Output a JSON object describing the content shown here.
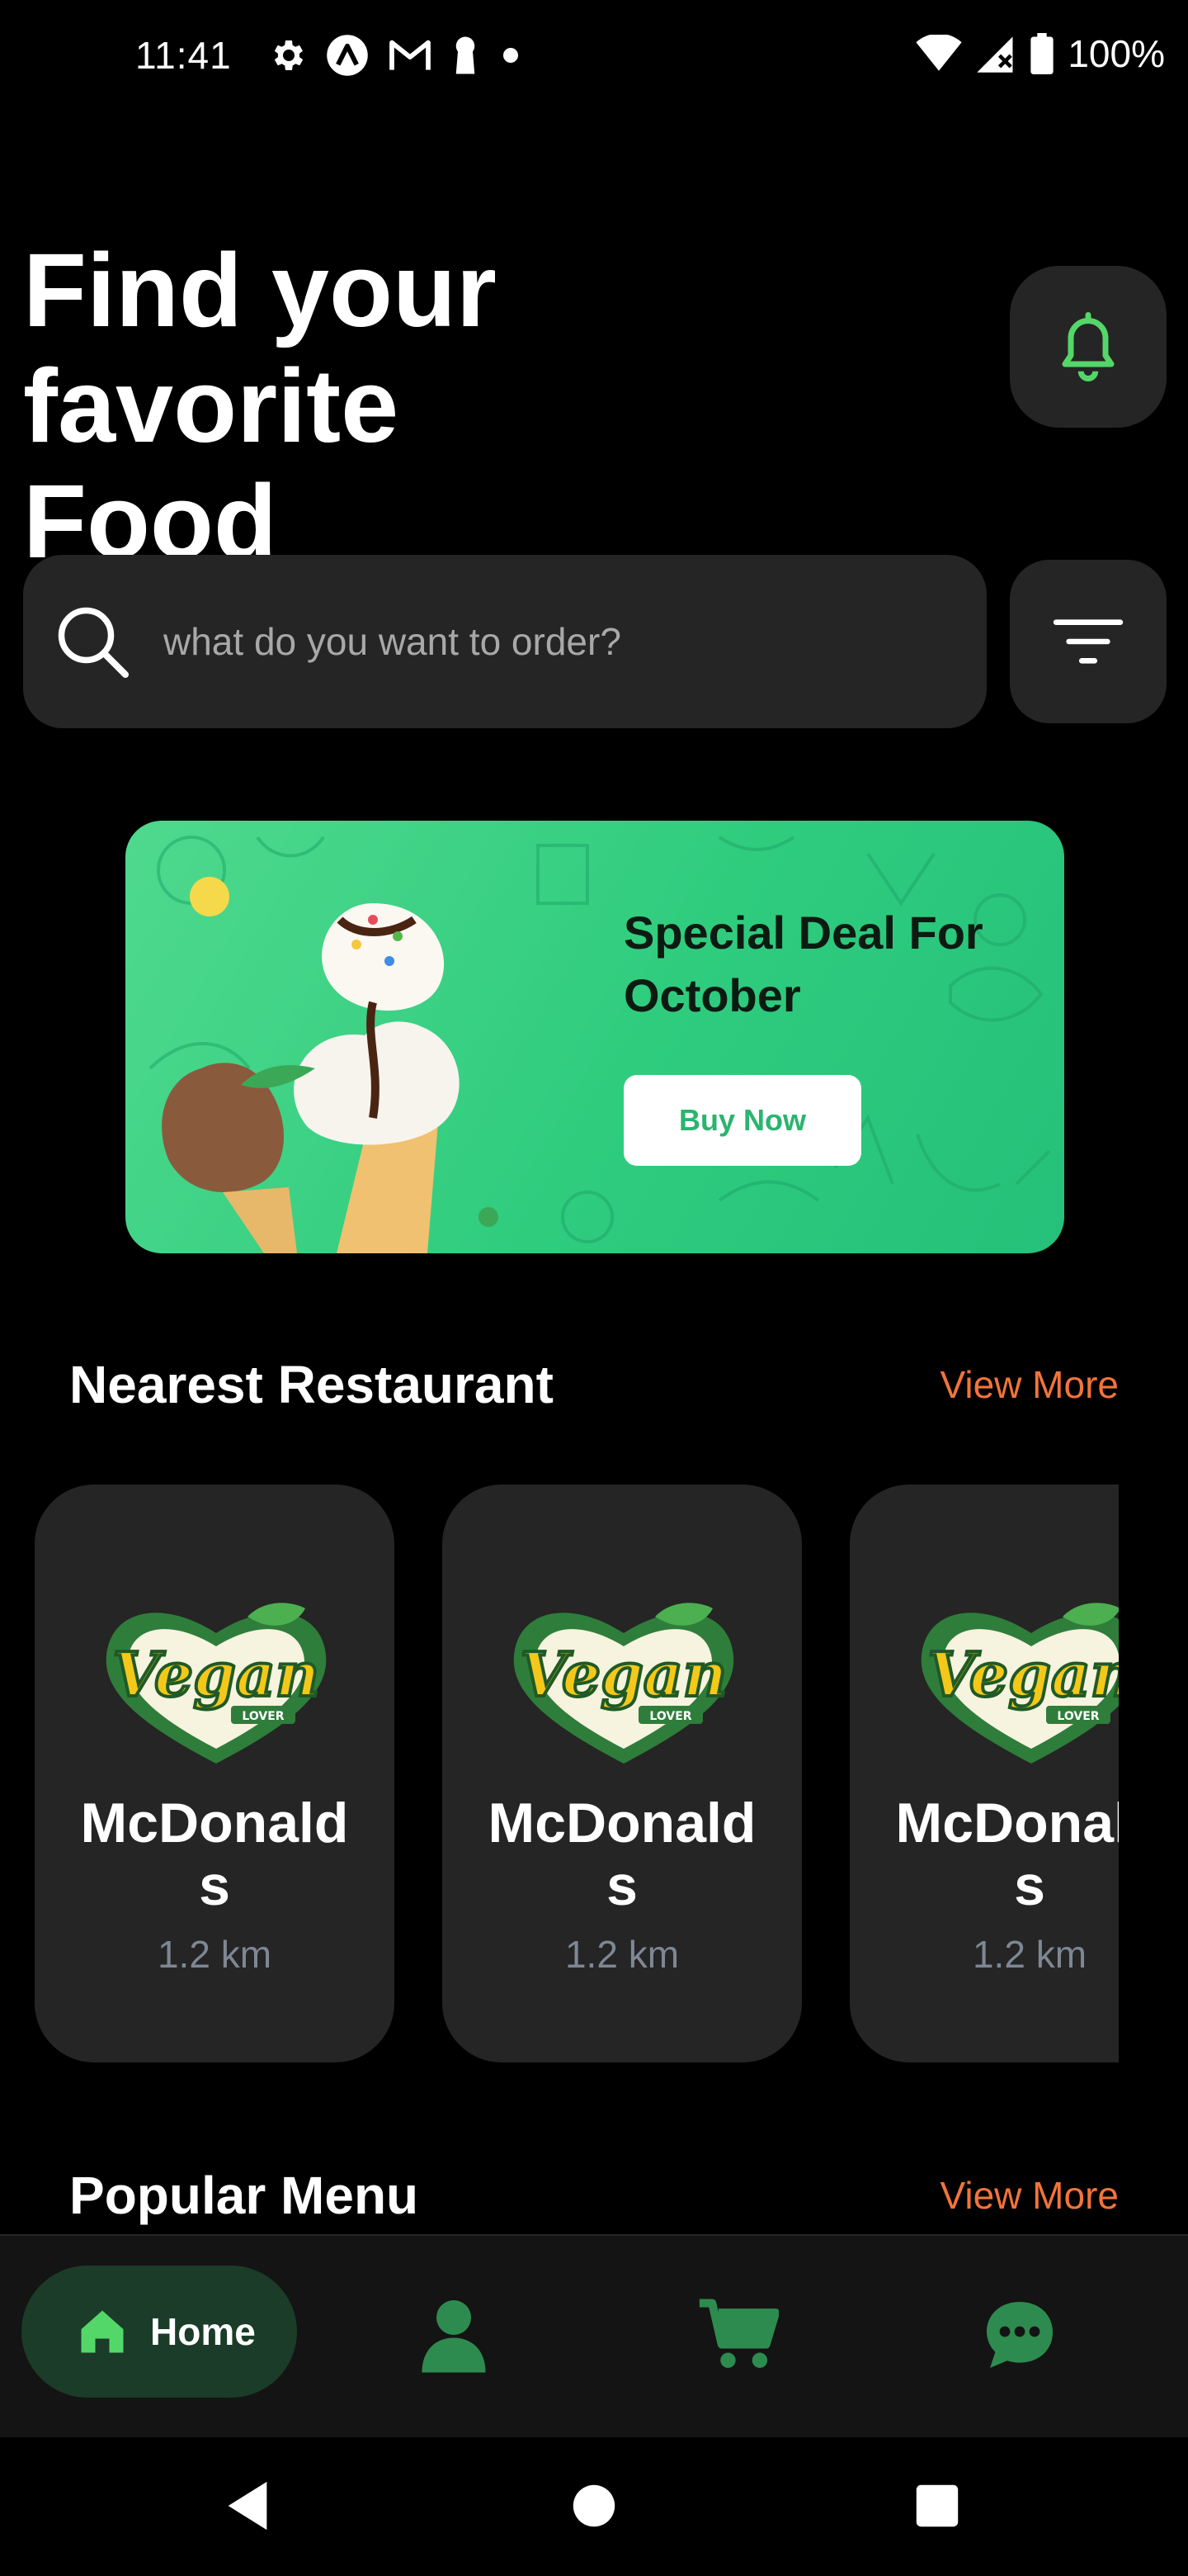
{
  "status_bar": {
    "time": "11:41",
    "battery": "100%",
    "left_icons": [
      "settings-icon",
      "app-a-icon",
      "gmail-icon",
      "keyhole-icon",
      "dot-icon"
    ],
    "right_icons": [
      "wifi-icon",
      "signal-icon",
      "battery-icon"
    ]
  },
  "header": {
    "title_line1": "Find your favorite",
    "title_line2": "Food",
    "notification_icon": "bell-icon"
  },
  "search": {
    "placeholder": "what do you want to order?",
    "icon": "search-icon",
    "filter_icon": "filter-icon"
  },
  "promo": {
    "title_line1": "Special Deal For",
    "title_line2": "October",
    "button_label": "Buy Now"
  },
  "nearest": {
    "title": "Nearest Restaurant",
    "view_more": "View More",
    "restaurants": [
      {
        "name": "McDonalds",
        "distance": "1.2 km",
        "logo_text": "Vegan",
        "logo_sub": "LOVER"
      },
      {
        "name": "McDonalds",
        "distance": "1.2 km",
        "logo_text": "Vegan",
        "logo_sub": "LOVER"
      },
      {
        "name": "McDonalds",
        "distance": "1.2 km",
        "logo_text": "Vegan",
        "logo_sub": "LOVER"
      }
    ]
  },
  "popular": {
    "title": "Popular Menu",
    "view_more": "View More"
  },
  "bottom_nav": {
    "home_label": "Home",
    "items": [
      "home-icon",
      "profile-icon",
      "cart-icon",
      "chat-icon"
    ]
  },
  "colors": {
    "accent_green": "#53d769",
    "nav_green": "#2e8b4f",
    "orange": "#f2743a",
    "card_bg": "#252525",
    "banner_green": "#33cc7f"
  }
}
